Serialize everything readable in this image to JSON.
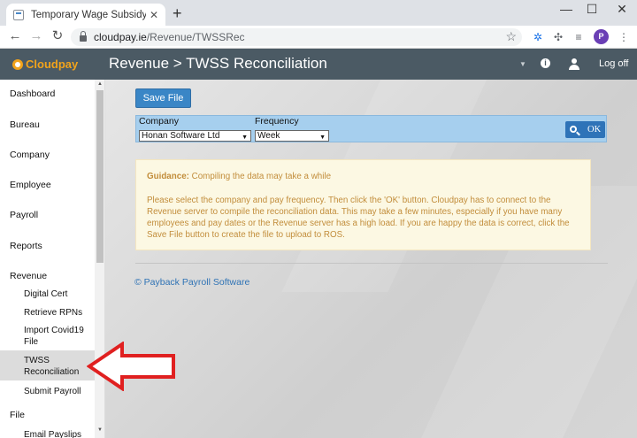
{
  "browser": {
    "tab_title": "Temporary Wage Subsidy Scheme",
    "tab_close": "✕",
    "new_tab": "+",
    "url_host": "cloudpay.ie",
    "url_path": "/Revenue/TWSSRec",
    "profile_initial": "P",
    "win_minimize": "—",
    "win_maximize": "☐",
    "win_close": "✕"
  },
  "header": {
    "logo_text": "Cloudpay",
    "title": "Revenue > TWSS Reconciliation",
    "logoff_label": "Log off",
    "info_glyph": "i",
    "bg_color": "#4b5a64"
  },
  "sidebar": {
    "items": [
      {
        "label": "Dashboard"
      },
      {
        "label": "Bureau"
      },
      {
        "label": "Company"
      },
      {
        "label": "Employee"
      },
      {
        "label": "Payroll"
      },
      {
        "label": "Reports"
      },
      {
        "label": "Revenue"
      }
    ],
    "revenue_sub": [
      {
        "label": "Digital Cert"
      },
      {
        "label": "Retrieve RPNs"
      },
      {
        "label": "Import Covid19 File"
      },
      {
        "label": "TWSS Reconciliation"
      },
      {
        "label": "Submit Payroll"
      }
    ],
    "file_label": "File",
    "file_sub": [
      {
        "label": "Email Payslips"
      }
    ]
  },
  "main": {
    "save_label": "Save File",
    "company_label": "Company",
    "company_value": "Honan Software Ltd",
    "frequency_label": "Frequency",
    "frequency_value": "Week",
    "ok_label": "OK",
    "guidance_head": "Guidance:",
    "guidance_line": "Compiling the data may take a while",
    "guidance_body": "Please select the company and pay frequency. Then click the 'OK' button. Cloudpay has to connect to the Revenue server to compile the reconciliation data. This may take a few minutes, especially if you have many employees and pay dates or the Revenue server has a high load. If you are happy the data is correct, click the Save File button to create the file to upload to ROS.",
    "footer_link": "© Payback Payroll Software"
  },
  "colors": {
    "accent": "#3a86c6",
    "filter_bg": "#a6cfee",
    "guidance_text": "#c28d3b",
    "arrow": "#e02020"
  }
}
